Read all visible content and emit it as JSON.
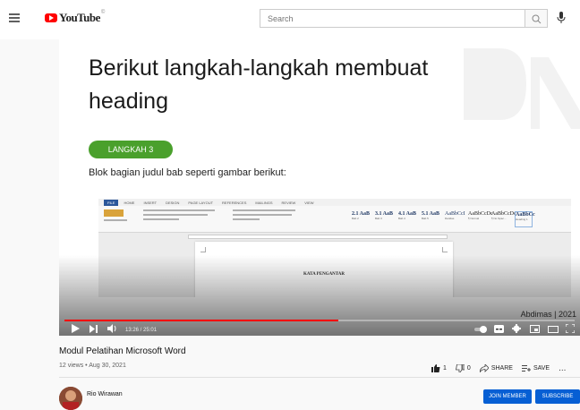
{
  "header": {
    "logo_text": "YouTube",
    "logo_suffix": "©",
    "search_placeholder": "Search",
    "icons": [
      "menu-icon",
      "search-icon",
      "mic-icon"
    ]
  },
  "video": {
    "slide": {
      "title": "Berikut langkah-langkah membuat heading",
      "step_badge": "LANGKAH 3",
      "body": "Blok bagian judul bab seperti gambar berikut:",
      "word_tabs": [
        "FILE",
        "HOME",
        "INSERT",
        "DESIGN",
        "PAGE LAYOUT",
        "REFERENCES",
        "MAILINGS",
        "REVIEW",
        "VIEW"
      ],
      "word_styles": [
        {
          "sample": "2.1 AaB",
          "label": "Bab 2"
        },
        {
          "sample": "3.1 AaB",
          "label": "Bab 3"
        },
        {
          "sample": "4.1 AaB",
          "label": "Bab 4"
        },
        {
          "sample": "5.1 AaB",
          "label": "Bab 5"
        },
        {
          "sample": "AaBbCcI",
          "label": "Daridas"
        },
        {
          "sample": "AaBbCcDc",
          "label": "¶ Normal"
        },
        {
          "sample": "AaBbCcDc",
          "label": "¶ No Spac..."
        },
        {
          "sample": "AaBbCc",
          "label": "Heading 1"
        }
      ],
      "page_heading": "KATA PENGANTAR",
      "watermark": "Abdimas | 2021"
    },
    "player": {
      "time": "13:26 / 25:01",
      "progress": 0.536
    }
  },
  "info": {
    "title": "Modul Pelatihan Microsoft Word",
    "meta": "12 views • Aug 30, 2021",
    "like_count": "1",
    "dislike_count": "0",
    "share_label": "SHARE",
    "save_label": "SAVE",
    "more": "..."
  },
  "channel": {
    "name": "Rio Wirawan",
    "button_join": "JOIN MEMBER",
    "button_subscribe": "SUBSCRIBE"
  }
}
